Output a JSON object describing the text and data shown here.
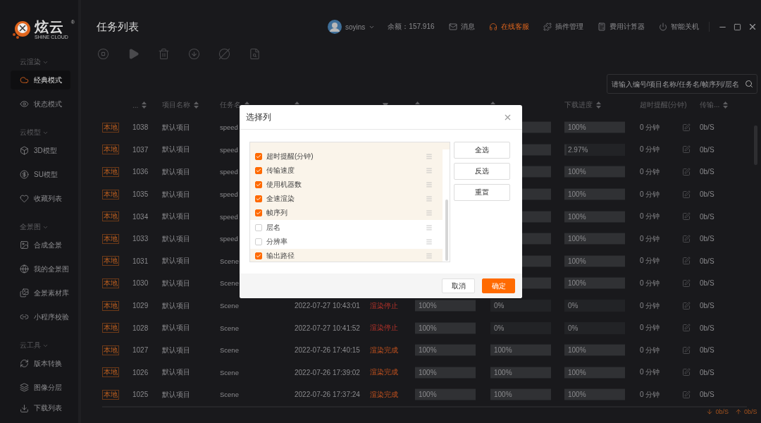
{
  "brand": {
    "name": "炫云",
    "subtitle": "SHINE CLOUD",
    "mark": "®"
  },
  "page_title": "任务列表",
  "sidebar": {
    "sections": [
      {
        "title": "云渲染",
        "items": [
          {
            "label": "经典模式",
            "kind": "cloud",
            "selected": true
          },
          {
            "label": "状态模式",
            "kind": "eye",
            "selected": false
          }
        ]
      },
      {
        "title": "云模型",
        "items": [
          {
            "label": "3D模型",
            "kind": "box",
            "selected": false
          },
          {
            "label": "SU模型",
            "kind": "coin",
            "selected": false
          },
          {
            "label": "收藏列表",
            "kind": "heart",
            "selected": false
          }
        ]
      },
      {
        "title": "全景图",
        "items": [
          {
            "label": "合成全景",
            "kind": "image",
            "selected": false
          },
          {
            "label": "我的全景图",
            "kind": "globe",
            "selected": false
          },
          {
            "label": "全景素材库",
            "kind": "gallery",
            "selected": false
          },
          {
            "label": "小程序校验",
            "kind": "link",
            "selected": false
          }
        ]
      },
      {
        "title": "云工具",
        "items": [
          {
            "label": "版本转换",
            "kind": "refresh",
            "selected": false
          },
          {
            "label": "图像分层",
            "kind": "layers",
            "selected": false
          }
        ]
      }
    ],
    "bottom_item": {
      "label": "下载列表",
      "kind": "download",
      "selected": false
    }
  },
  "topbar": {
    "user": "soyins",
    "balance": "余额：157.916",
    "items": [
      {
        "label": "消息",
        "kind": "mail",
        "active": false
      },
      {
        "label": "在线客服",
        "kind": "headset",
        "active": true
      },
      {
        "label": "插件管理",
        "kind": "puzzle",
        "active": false
      },
      {
        "label": "费用计算器",
        "kind": "calculator",
        "active": false
      },
      {
        "label": "智能关机",
        "kind": "power",
        "active": false
      }
    ]
  },
  "search": {
    "placeholder": "请输入编号/项目名称/任务名/帧序列/层名"
  },
  "table": {
    "columns": [
      {
        "kind": "blank"
      },
      {
        "kind": "header",
        "label": "...",
        "sortable": true
      },
      {
        "kind": "header",
        "label": "项目名称",
        "sortable": true
      },
      {
        "kind": "header",
        "label": "任务名",
        "sortable": true
      },
      {
        "kind": "header",
        "sortable": true
      },
      {
        "kind": "filter"
      },
      {
        "kind": "header",
        "sortable": true
      },
      {
        "kind": "header",
        "sortable": true
      },
      {
        "kind": "header",
        "label": "下载进度",
        "sortable": true
      },
      {
        "kind": "header",
        "label": "超时提醒(分钟)",
        "sortable": false
      },
      {
        "kind": "blank"
      },
      {
        "kind": "header",
        "label": "传输...",
        "sortable": true
      }
    ],
    "rows": [
      {
        "source": "本地",
        "id": "1038",
        "project": "默认项目",
        "task": "speed",
        "render": {
          "level": 1
        },
        "download": {
          "level": 1,
          "text": "100%"
        },
        "timeout": "0 分钟",
        "speed": "0b/S"
      },
      {
        "source": "本地",
        "id": "1037",
        "project": "默认项目",
        "task": "speed",
        "render": {
          "level": 1
        },
        "download": {
          "level": 0.0297,
          "text": "2.97%"
        },
        "timeout": "0 分钟",
        "speed": "0b/S"
      },
      {
        "source": "本地",
        "id": "1036",
        "project": "默认项目",
        "task": "speed",
        "render": {
          "level": 1
        },
        "download": {
          "level": 1,
          "text": "100%"
        },
        "timeout": "0 分钟",
        "speed": "0b/S"
      },
      {
        "source": "本地",
        "id": "1035",
        "project": "默认项目",
        "task": "speed",
        "render": {
          "level": 1
        },
        "download": {
          "level": 1,
          "text": "100%"
        },
        "timeout": "0 分钟",
        "speed": "0b/S"
      },
      {
        "source": "本地",
        "id": "1034",
        "project": "默认项目",
        "task": "speed",
        "render": {
          "level": 1
        },
        "download": {
          "level": 1,
          "text": "100%"
        },
        "timeout": "0 分钟",
        "speed": "0b/S"
      },
      {
        "source": "本地",
        "id": "1033",
        "project": "默认项目",
        "task": "speed",
        "render": {
          "level": 1
        },
        "download": {
          "level": 1,
          "text": "100%"
        },
        "timeout": "0 分钟",
        "speed": "0b/S"
      },
      {
        "source": "本地",
        "id": "1031",
        "project": "默认项目",
        "task": "Scene",
        "render": {
          "level": 1
        },
        "download": {
          "level": 1,
          "text": "100%"
        },
        "timeout": "0 分钟",
        "speed": "0b/S"
      },
      {
        "source": "本地",
        "id": "1030",
        "project": "默认项目",
        "task": "Scene",
        "render": {
          "level": 1
        },
        "download": {
          "level": 1,
          "text": "100%"
        },
        "timeout": "0 分钟",
        "speed": "0b/S"
      },
      {
        "source": "本地",
        "id": "1029",
        "project": "默认项目",
        "task": "Scene",
        "date": "2022-07-27 10:43:01",
        "status": {
          "text": "渲染停止",
          "kind": "stopped"
        },
        "upload": {
          "level": 1,
          "text": "100%"
        },
        "render": {
          "level": 0,
          "text": "0%"
        },
        "download": {
          "level": 0,
          "text": "0%"
        },
        "timeout": "0 分钟",
        "speed": "0b/S"
      },
      {
        "source": "本地",
        "id": "1028",
        "project": "默认项目",
        "task": "Scene",
        "date": "2022-07-27 10:41:52",
        "status": {
          "text": "渲染停止",
          "kind": "stopped"
        },
        "upload": {
          "level": 1,
          "text": "100%"
        },
        "render": {
          "level": 0,
          "text": "0%"
        },
        "download": {
          "level": 0,
          "text": "0%"
        },
        "timeout": "0 分钟",
        "speed": "0b/S"
      },
      {
        "source": "本地",
        "id": "1027",
        "project": "默认项目",
        "task": "Scene",
        "date": "2022-07-26 17:40:15",
        "status": {
          "text": "渲染完成",
          "kind": "done"
        },
        "upload": {
          "level": 1,
          "text": "100%"
        },
        "render": {
          "level": 1,
          "text": "100%"
        },
        "download": {
          "level": 1,
          "text": "100%"
        },
        "timeout": "0 分钟",
        "speed": "0b/S"
      },
      {
        "source": "本地",
        "id": "1026",
        "project": "默认项目",
        "task": "Scene",
        "date": "2022-07-26 17:39:02",
        "status": {
          "text": "渲染完成",
          "kind": "done"
        },
        "upload": {
          "level": 1,
          "text": "100%"
        },
        "render": {
          "level": 1,
          "text": "100%"
        },
        "download": {
          "level": 1,
          "text": "100%"
        },
        "timeout": "0 分钟",
        "speed": "0b/S"
      },
      {
        "source": "本地",
        "id": "1025",
        "project": "默认项目",
        "task": "Scene",
        "date": "2022-07-26 17:37:24",
        "status": {
          "text": "渲染完成",
          "kind": "done"
        },
        "upload": {
          "level": 1,
          "text": "100%"
        },
        "render": {
          "level": 1,
          "text": "100%"
        },
        "download": {
          "level": 1,
          "text": "100%"
        },
        "timeout": "0 分钟",
        "speed": "0b/S"
      }
    ]
  },
  "status_bar": {
    "download": "0b/S",
    "upload": "0b/S"
  },
  "modal": {
    "title": "选择列",
    "columns": [
      {
        "label": "超时提醒(分钟)",
        "checked": true
      },
      {
        "label": "传输速度",
        "checked": true
      },
      {
        "label": "使用机器数",
        "checked": true
      },
      {
        "label": "全速渲染",
        "checked": true
      },
      {
        "label": "帧序列",
        "checked": true
      },
      {
        "label": "层名",
        "checked": false
      },
      {
        "label": "分辨率",
        "checked": false
      },
      {
        "label": "输出路径",
        "checked": true
      }
    ],
    "side_buttons": [
      "全选",
      "反选",
      "重置"
    ],
    "cancel": "取消",
    "confirm": "确定"
  }
}
